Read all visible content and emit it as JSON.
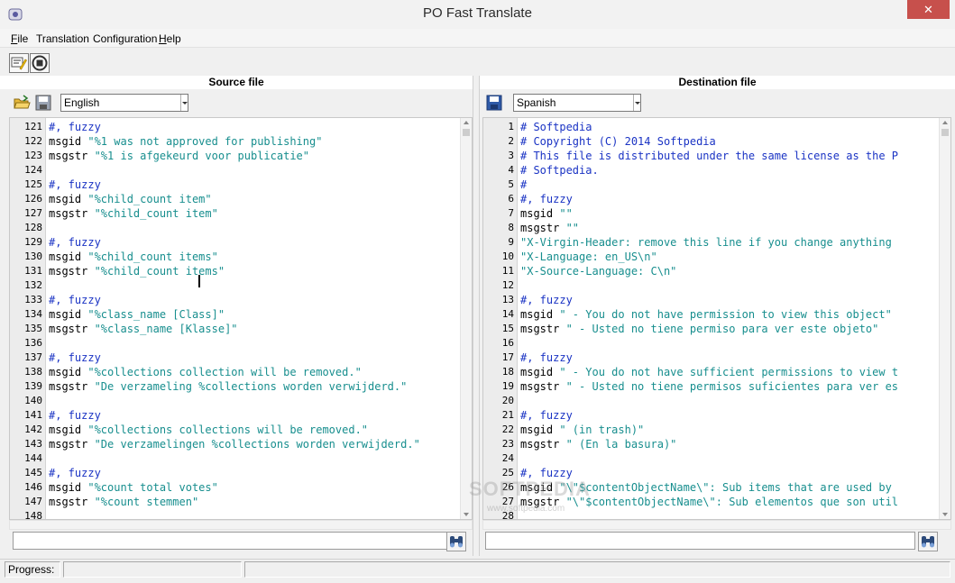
{
  "window": {
    "title": "PO Fast Translate",
    "close_glyph": "✕"
  },
  "menu": [
    {
      "label": "File",
      "accel": "F",
      "rest": "ile"
    },
    {
      "label": "Translation",
      "accel": "",
      "rest": "Translation"
    },
    {
      "label": "Configuration",
      "accel": "",
      "rest": "Configuration"
    },
    {
      "label": "Help",
      "accel": "H",
      "rest": "elp"
    }
  ],
  "source": {
    "title": "Source file",
    "language": "English",
    "lines": [
      {
        "n": "121",
        "parts": [
          [
            "c-comment",
            "#, fuzzy"
          ]
        ]
      },
      {
        "n": "122",
        "parts": [
          [
            "c-key",
            "msgid "
          ],
          [
            "c-str",
            "\"%1 was not approved for publishing\""
          ]
        ]
      },
      {
        "n": "123",
        "parts": [
          [
            "c-key",
            "msgstr "
          ],
          [
            "c-str",
            "\"%1 is afgekeurd voor publicatie\""
          ]
        ]
      },
      {
        "n": "124",
        "parts": []
      },
      {
        "n": "125",
        "parts": [
          [
            "c-comment",
            "#, fuzzy"
          ]
        ]
      },
      {
        "n": "126",
        "parts": [
          [
            "c-key",
            "msgid "
          ],
          [
            "c-str",
            "\"%child_count item\""
          ]
        ]
      },
      {
        "n": "127",
        "parts": [
          [
            "c-key",
            "msgstr "
          ],
          [
            "c-str",
            "\"%child_count item\""
          ]
        ]
      },
      {
        "n": "128",
        "parts": []
      },
      {
        "n": "129",
        "parts": [
          [
            "c-comment",
            "#, fuzzy"
          ]
        ]
      },
      {
        "n": "130",
        "parts": [
          [
            "c-key",
            "msgid "
          ],
          [
            "c-str",
            "\"%child_count items\""
          ]
        ]
      },
      {
        "n": "131",
        "parts": [
          [
            "c-key",
            "msgstr "
          ],
          [
            "c-str",
            "\"%child_count items\""
          ]
        ]
      },
      {
        "n": "132",
        "parts": []
      },
      {
        "n": "133",
        "parts": [
          [
            "c-comment",
            "#, fuzzy"
          ]
        ]
      },
      {
        "n": "134",
        "parts": [
          [
            "c-key",
            "msgid "
          ],
          [
            "c-str",
            "\"%class_name [Class]\""
          ]
        ]
      },
      {
        "n": "135",
        "parts": [
          [
            "c-key",
            "msgstr "
          ],
          [
            "c-str",
            "\"%class_name [Klasse]\""
          ]
        ]
      },
      {
        "n": "136",
        "parts": []
      },
      {
        "n": "137",
        "parts": [
          [
            "c-comment",
            "#, fuzzy"
          ]
        ]
      },
      {
        "n": "138",
        "parts": [
          [
            "c-key",
            "msgid "
          ],
          [
            "c-str",
            "\"%collections collection will be removed.\""
          ]
        ]
      },
      {
        "n": "139",
        "parts": [
          [
            "c-key",
            "msgstr "
          ],
          [
            "c-str",
            "\"De verzameling %collections worden verwijderd.\""
          ]
        ]
      },
      {
        "n": "140",
        "parts": []
      },
      {
        "n": "141",
        "parts": [
          [
            "c-comment",
            "#, fuzzy"
          ]
        ]
      },
      {
        "n": "142",
        "parts": [
          [
            "c-key",
            "msgid "
          ],
          [
            "c-str",
            "\"%collections collections will be removed.\""
          ]
        ]
      },
      {
        "n": "143",
        "parts": [
          [
            "c-key",
            "msgstr "
          ],
          [
            "c-str",
            "\"De verzamelingen %collections worden verwijderd.\""
          ]
        ]
      },
      {
        "n": "144",
        "parts": []
      },
      {
        "n": "145",
        "parts": [
          [
            "c-comment",
            "#, fuzzy"
          ]
        ]
      },
      {
        "n": "146",
        "parts": [
          [
            "c-key",
            "msgid "
          ],
          [
            "c-str",
            "\"%count total votes\""
          ]
        ]
      },
      {
        "n": "147",
        "parts": [
          [
            "c-key",
            "msgstr "
          ],
          [
            "c-str",
            "\"%count stemmen\""
          ]
        ]
      },
      {
        "n": "148",
        "parts": []
      }
    ],
    "search_value": ""
  },
  "destination": {
    "title": "Destination file",
    "language": "Spanish",
    "lines": [
      {
        "n": "1",
        "parts": [
          [
            "c-comment",
            "# Softpedia"
          ]
        ]
      },
      {
        "n": "2",
        "parts": [
          [
            "c-comment",
            "# Copyright (C) 2014 Softpedia"
          ]
        ]
      },
      {
        "n": "3",
        "parts": [
          [
            "c-comment",
            "# This file is distributed under the same license as the P"
          ]
        ]
      },
      {
        "n": "4",
        "parts": [
          [
            "c-comment",
            "# Softpedia."
          ]
        ]
      },
      {
        "n": "5",
        "parts": [
          [
            "c-comment",
            "#"
          ]
        ]
      },
      {
        "n": "6",
        "parts": [
          [
            "c-comment",
            "#, fuzzy"
          ]
        ]
      },
      {
        "n": "7",
        "parts": [
          [
            "c-key",
            "msgid "
          ],
          [
            "c-str",
            "\"\""
          ]
        ]
      },
      {
        "n": "8",
        "parts": [
          [
            "c-key",
            "msgstr "
          ],
          [
            "c-str",
            "\"\""
          ]
        ]
      },
      {
        "n": "9",
        "parts": [
          [
            "c-str",
            "\"X-Virgin-Header: remove this line if you change anything"
          ]
        ]
      },
      {
        "n": "10",
        "parts": [
          [
            "c-str",
            "\"X-Language: en_US\\n\""
          ]
        ]
      },
      {
        "n": "11",
        "parts": [
          [
            "c-str",
            "\"X-Source-Language: C\\n\""
          ]
        ]
      },
      {
        "n": "12",
        "parts": []
      },
      {
        "n": "13",
        "parts": [
          [
            "c-comment",
            "#, fuzzy"
          ]
        ]
      },
      {
        "n": "14",
        "parts": [
          [
            "c-key",
            "msgid "
          ],
          [
            "c-str",
            "\" - You do not have permission to view this object\""
          ]
        ]
      },
      {
        "n": "15",
        "parts": [
          [
            "c-key",
            "msgstr "
          ],
          [
            "c-str",
            "\" - Usted no tiene permiso para ver este objeto\""
          ]
        ]
      },
      {
        "n": "16",
        "parts": []
      },
      {
        "n": "17",
        "parts": [
          [
            "c-comment",
            "#, fuzzy"
          ]
        ]
      },
      {
        "n": "18",
        "parts": [
          [
            "c-key",
            "msgid "
          ],
          [
            "c-str",
            "\" - You do not have sufficient permissions to view t"
          ]
        ]
      },
      {
        "n": "19",
        "parts": [
          [
            "c-key",
            "msgstr "
          ],
          [
            "c-str",
            "\" - Usted no tiene permisos suficientes para ver es"
          ]
        ]
      },
      {
        "n": "20",
        "parts": []
      },
      {
        "n": "21",
        "parts": [
          [
            "c-comment",
            "#, fuzzy"
          ]
        ]
      },
      {
        "n": "22",
        "parts": [
          [
            "c-key",
            "msgid "
          ],
          [
            "c-str",
            "\" (in trash)\""
          ]
        ]
      },
      {
        "n": "23",
        "parts": [
          [
            "c-key",
            "msgstr "
          ],
          [
            "c-str",
            "\" (En la basura)\""
          ]
        ]
      },
      {
        "n": "24",
        "parts": []
      },
      {
        "n": "25",
        "parts": [
          [
            "c-comment",
            "#, fuzzy"
          ]
        ]
      },
      {
        "n": "26",
        "parts": [
          [
            "c-key",
            "msgid "
          ],
          [
            "c-str",
            "\"\\\"$contentObjectName\\\": Sub items that are used by"
          ]
        ]
      },
      {
        "n": "27",
        "parts": [
          [
            "c-key",
            "msgstr "
          ],
          [
            "c-str",
            "\"\\\"$contentObjectName\\\": Sub elementos que son util"
          ]
        ]
      },
      {
        "n": "28",
        "parts": []
      }
    ],
    "search_value": ""
  },
  "status": {
    "progress_label": "Progress:",
    "progress_value": 0
  },
  "watermark": {
    "text": "SOFTPEDIA",
    "sub": "www.softpedia.com"
  },
  "colors": {
    "comment": "#1a33c4",
    "string": "#178e8e",
    "close": "#c7504c"
  },
  "icons": [
    "app-icon",
    "translate-wand-icon",
    "stop-icon",
    "open-folder-icon",
    "save-disk-icon",
    "binoculars-icon"
  ]
}
